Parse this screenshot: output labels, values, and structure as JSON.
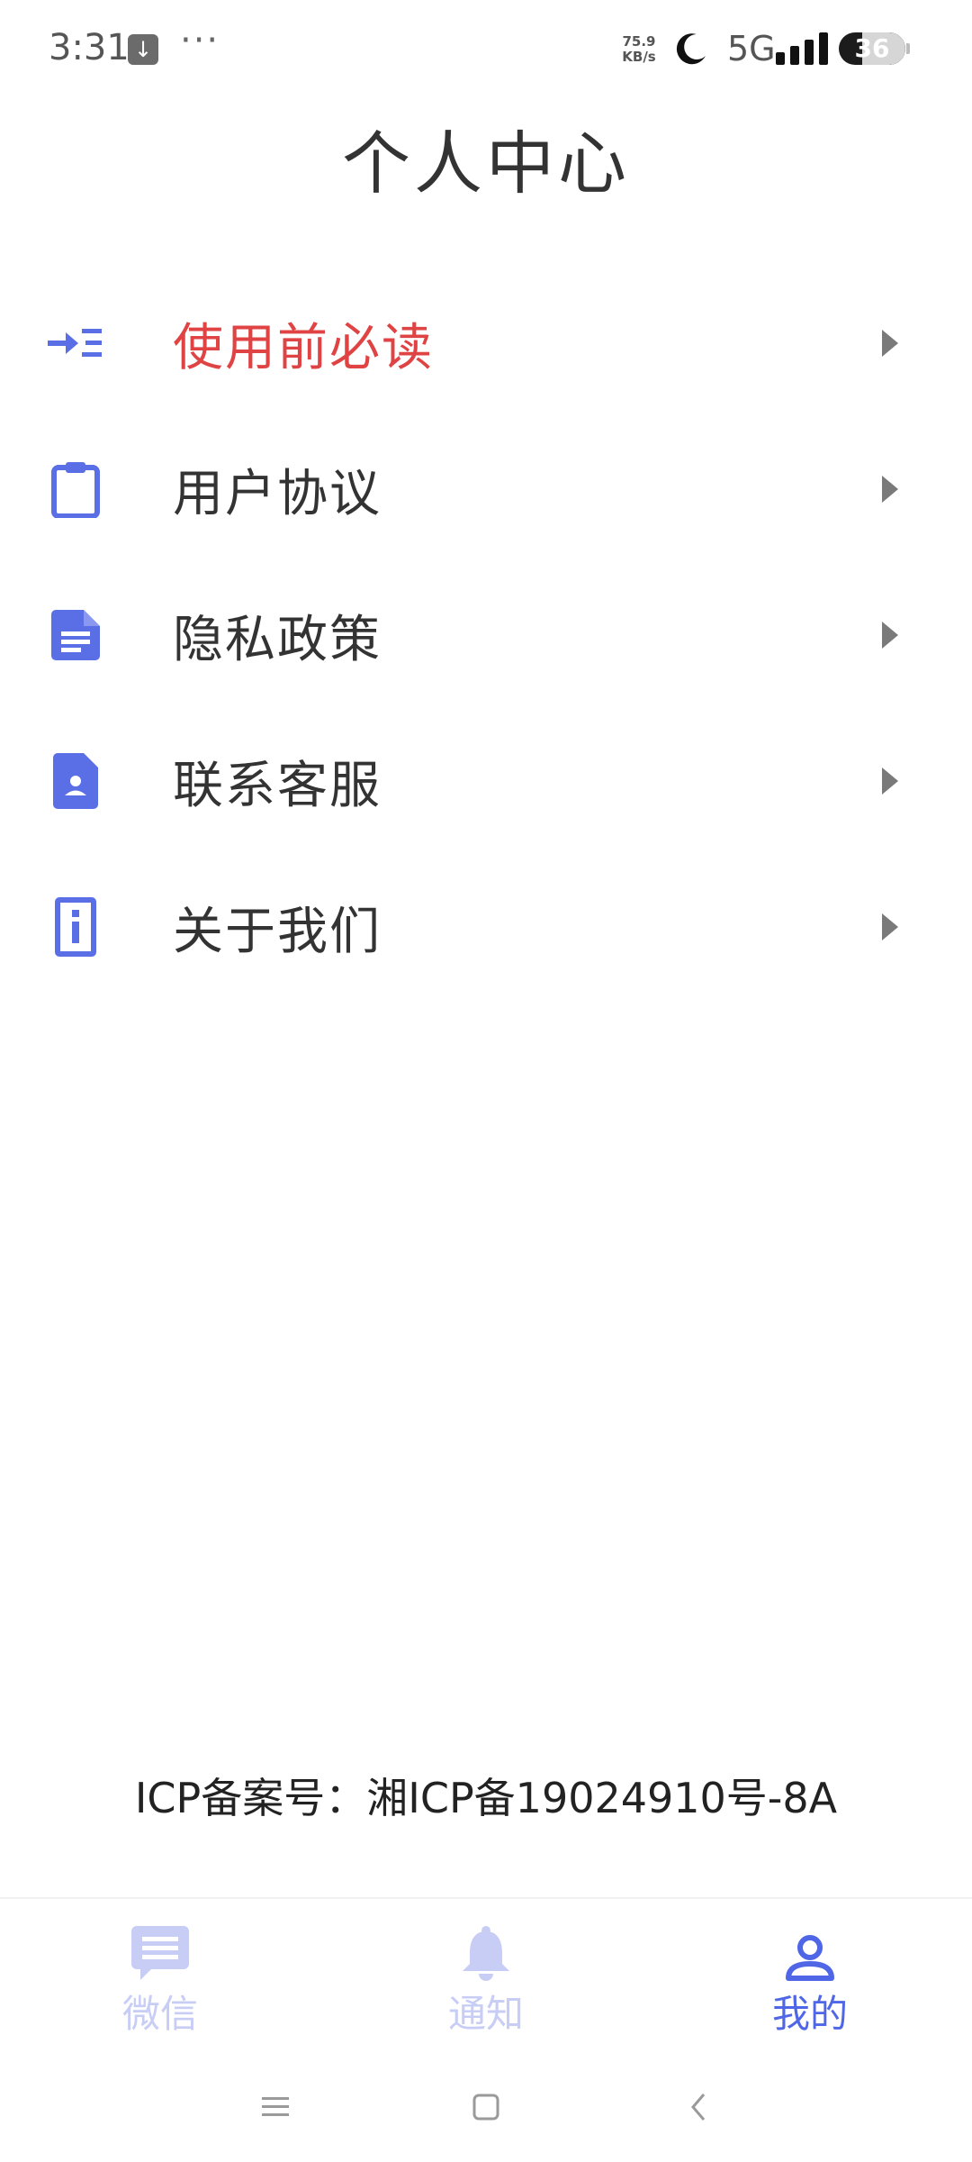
{
  "status_bar": {
    "time": "3:31",
    "download_glyph": "↓",
    "more": "···",
    "net_speed_value": "75.9",
    "net_speed_unit": "KB/s",
    "network": "5G",
    "battery": "36",
    "icons": [
      "download-notification-icon",
      "moon-icon",
      "signal-icon",
      "battery-icon"
    ]
  },
  "header": {
    "title": "个人中心"
  },
  "menu": {
    "items": [
      {
        "label": "使用前必读",
        "icon": "menu-indent-icon",
        "highlight": true
      },
      {
        "label": "用户协议",
        "icon": "clipboard-icon",
        "highlight": false
      },
      {
        "label": "隐私政策",
        "icon": "document-icon",
        "highlight": false
      },
      {
        "label": "联系客服",
        "icon": "contact-file-icon",
        "highlight": false
      },
      {
        "label": "关于我们",
        "icon": "info-icon",
        "highlight": false
      }
    ]
  },
  "footer": {
    "icp": "ICP备案号：湘ICP备19024910号-8A"
  },
  "tabs": [
    {
      "label": "微信",
      "icon": "chat-icon",
      "active": false
    },
    {
      "label": "通知",
      "icon": "bell-icon",
      "active": false
    },
    {
      "label": "我的",
      "icon": "user-icon",
      "active": true
    }
  ],
  "colors": {
    "accent": "#4f67e6",
    "icon_blue": "#5a6ee6",
    "highlight_red": "#e04343",
    "inactive_tab": "#c8cdf6"
  }
}
